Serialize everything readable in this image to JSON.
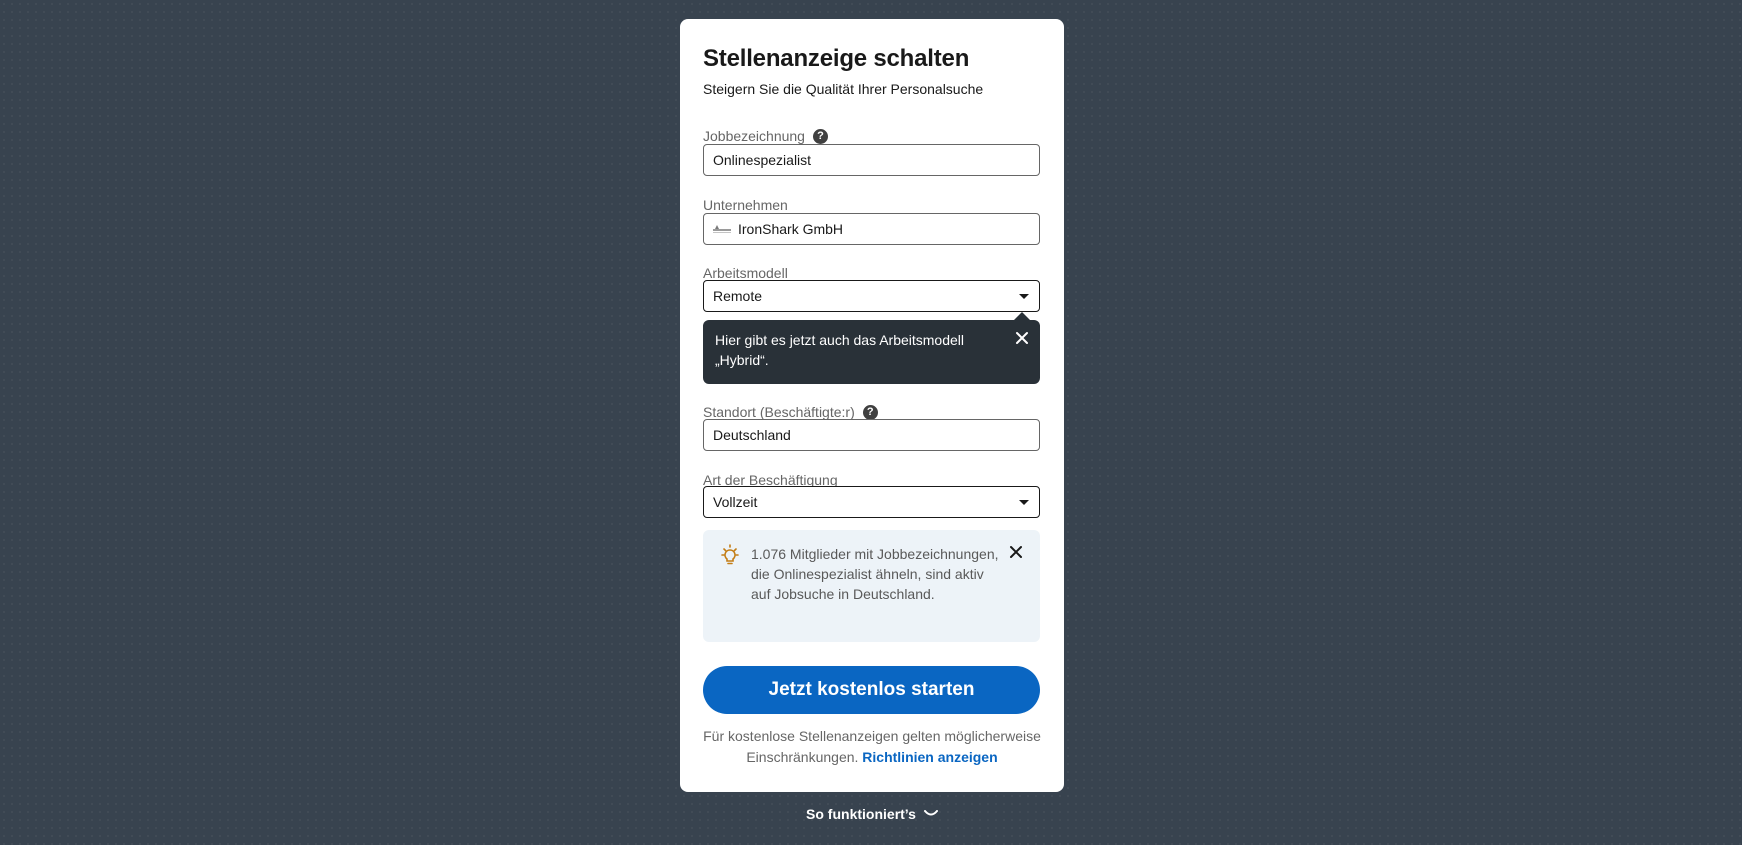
{
  "form": {
    "title": "Stellenanzeige schalten",
    "subtitle": "Steigern Sie die Qualität Ihrer Personalsuche",
    "job_title": {
      "label": "Jobbezeichnung",
      "value": "Onlinespezialist"
    },
    "company": {
      "label": "Unternehmen",
      "value": "IronShark GmbH"
    },
    "work_model": {
      "label": "Arbeitsmodell",
      "value": "Remote"
    },
    "tooltip": {
      "text": "Hier gibt es jetzt auch das Arbeitsmodell „Hybrid“."
    },
    "location": {
      "label": "Standort (Beschäftigte:r)",
      "value": "Deutschland"
    },
    "employment_type": {
      "label": "Art der Beschäftigung",
      "value": "Vollzeit"
    },
    "insight": {
      "text": "1.076 Mitglieder mit Jobbezeichnungen, die Onlinespezialist ähneln, sind aktiv auf Jobsuche in Deutschland."
    },
    "cta_label": "Jetzt kostenlos starten",
    "disclaimer": {
      "text": "Für kostenlose Stellenanzeigen gelten möglicherweise Einschränkungen.",
      "link": "Richtlinien anzeigen"
    }
  },
  "footer": {
    "how_it_works": "So funktioniert’s"
  },
  "colors": {
    "background": "#38434f",
    "primary": "#0a66c2",
    "tooltip_bg": "#293138",
    "insight_bg": "#edf3f8",
    "bulb": "#c37d16"
  },
  "icons": {
    "help": "question-circle-icon",
    "close": "close-icon",
    "bulb": "lightbulb-icon",
    "caret": "caret-down-icon",
    "chevron": "chevron-down-icon"
  }
}
